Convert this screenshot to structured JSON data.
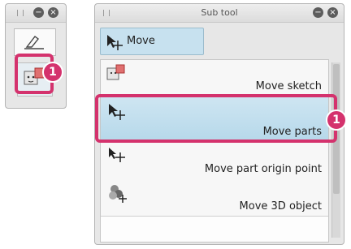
{
  "left_panel": {
    "buttons": {
      "minimize": "−",
      "close": "×"
    },
    "badge": "1"
  },
  "sub_tool": {
    "title": "Sub tool",
    "group_tab": "Move",
    "items": [
      {
        "label": "Move sketch",
        "icon": "move-sketch-icon",
        "selected": false
      },
      {
        "label": "Move parts",
        "icon": "move-parts-icon",
        "selected": true
      },
      {
        "label": "Move part origin point",
        "icon": "move-origin-icon",
        "selected": false
      },
      {
        "label": "Move 3D object",
        "icon": "move-3d-object-icon",
        "selected": false
      }
    ],
    "badge": "1"
  },
  "colors": {
    "highlight": "#d4326d",
    "selected_bg": "#b6d8ea"
  }
}
